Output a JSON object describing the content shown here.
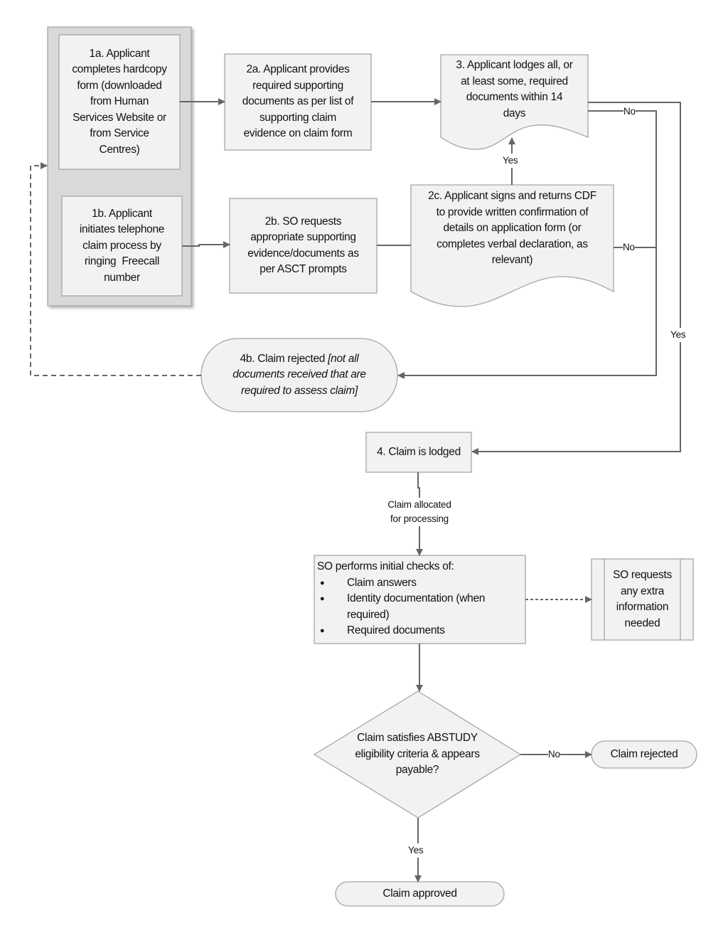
{
  "colors": {
    "fill": "#f2f2f2",
    "stroke": "#a6a6a6",
    "group_fill": "#d9d9d9",
    "connector": "#666666"
  },
  "nodes": {
    "n1a": "1a. Applicant\ncompletes hardcopy\nform (downloaded\nfrom Human\nServices Website or\nfrom Service\nCentres)",
    "n1b": "1b. Applicant\ninitiates telephone\nclaim process by\nringing  Freecall\nnumber",
    "n2a": "2a. Applicant provides\nrequired supporting\ndocuments as per list of\nsupporting claim\nevidence on claim form",
    "n2b": "2b. SO requests\nappropriate supporting\nevidence/documents as\nper ASCT prompts",
    "n2c": "2c. Applicant signs and returns CDF\nto provide written confirmation of\ndetails on application form (or\ncompletes verbal declaration, as\nrelevant)",
    "n3": "3. Applicant lodges all, or\nat least some, required\ndocuments within 14\ndays",
    "n4b_plain": "4b. Claim rejected ",
    "n4b_italic_1": "[not all",
    "n4b_italic_2": "documents received that are\nrequired to assess claim]",
    "n4": "4. Claim is lodged",
    "checks_title": "SO performs initial checks of:",
    "checks_items": [
      "Claim answers",
      "Identity documentation (when\nrequired)",
      "Required documents"
    ],
    "extra_info": "SO requests\nany extra\ninformation\nneeded",
    "decision": "Claim satisfies ABSTUDY\neligibility criteria & appears\npayable?",
    "rejected": "Claim rejected",
    "approved": "Claim approved"
  },
  "edge_labels": {
    "n3_no": "No",
    "n3_yes": "Yes",
    "n2c_yes": "Yes",
    "n2c_no": "No",
    "allocated": "Claim allocated\nfor processing",
    "decision_no": "No",
    "decision_yes": "Yes"
  }
}
